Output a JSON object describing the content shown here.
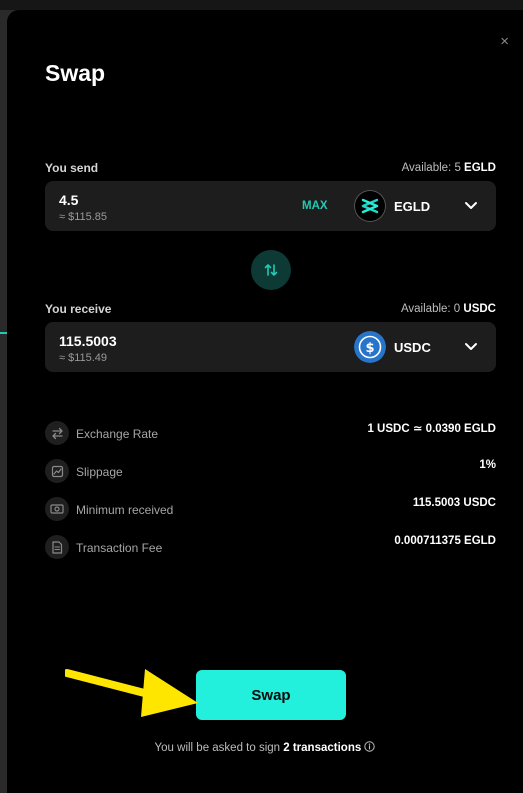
{
  "modal": {
    "title": "Swap",
    "close_glyph": "×"
  },
  "send": {
    "label": "You send",
    "available_prefix": "Available: 5",
    "available_token": "EGLD",
    "amount": "4.5",
    "usd": "≈ $115.85",
    "max_label": "MAX",
    "token": "EGLD",
    "token_icon": "egld-logo-icon"
  },
  "receive": {
    "label": "You receive",
    "available_prefix": "Available: 0",
    "available_token": "USDC",
    "amount": "115.5003",
    "usd": "≈ $115.49",
    "token": "USDC",
    "token_icon": "usdc-logo-icon"
  },
  "details": [
    {
      "icon": "exchange-icon",
      "label": "Exchange Rate",
      "value": "1 USDC ≃ 0.0390 EGLD"
    },
    {
      "icon": "chart-icon",
      "label": "Slippage",
      "value": "1%"
    },
    {
      "icon": "cash-icon",
      "label": "Minimum received",
      "value": "115.5003 USDC"
    },
    {
      "icon": "document-icon",
      "label": "Transaction Fee",
      "value": "0.000711375 EGLD"
    }
  ],
  "action": {
    "swap_label": "Swap",
    "note_prefix": "You will be asked to sign",
    "note_bold": "2 transactions",
    "note_icon": "info-icon"
  },
  "colors": {
    "accent": "#23c9b4",
    "button": "#23f0dc",
    "annotation_arrow": "#ffe600"
  }
}
